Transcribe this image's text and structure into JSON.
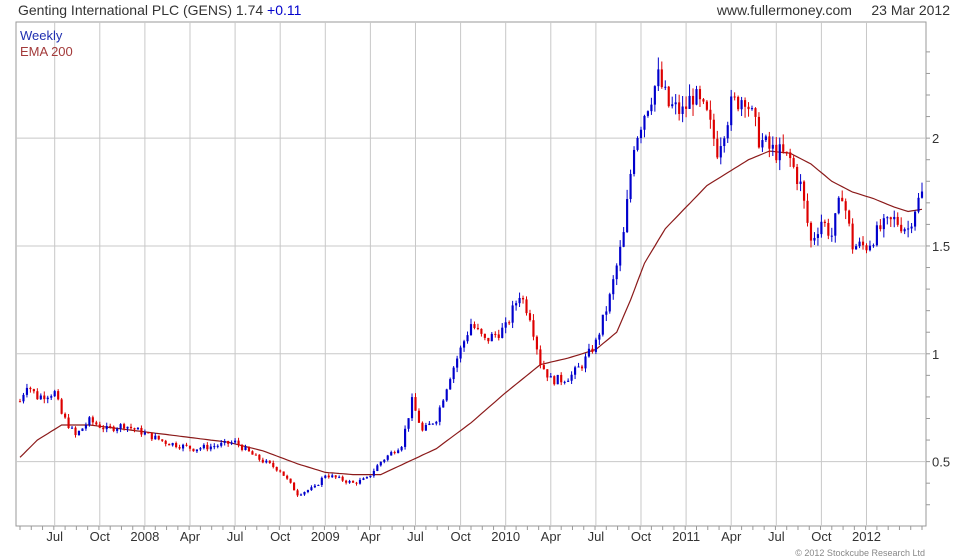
{
  "header": {
    "security": "Genting International PLC (GENS)",
    "price": "1.74",
    "change": "+0.11",
    "site": "www.fullermoney.com",
    "date": "23 Mar 2012"
  },
  "legend": {
    "weekly": "Weekly",
    "ema": "EMA 200"
  },
  "copyright": "© 2012 Stockcube Research Ltd",
  "colors": {
    "up": "#0000cc",
    "down": "#dd0000",
    "ema": "#8b1a1a",
    "grid": "#c8c8c8"
  },
  "chart_data": {
    "type": "candlestick",
    "title": "Genting International PLC (GENS)",
    "y_axis_position": "right",
    "ylim": [
      0.22,
      2.52
    ],
    "y_ticks": [
      0.5,
      1,
      1.5,
      2
    ],
    "x_ticks": [
      "Jul",
      "Oct",
      "2008",
      "Apr",
      "Jul",
      "Oct",
      "2009",
      "Apr",
      "Jul",
      "Oct",
      "2010",
      "Apr",
      "Jul",
      "Oct",
      "2011",
      "Apr",
      "Jul",
      "Oct",
      "2012"
    ],
    "x_range_weeks": [
      0,
      260
    ],
    "x_tick_weeks": [
      10,
      23,
      36,
      49,
      62,
      75,
      88,
      101,
      114,
      127,
      140,
      153,
      166,
      179,
      192,
      205,
      218,
      231,
      244
    ],
    "series": [
      {
        "name": "Weekly",
        "kind": "price",
        "anchors_week_close": [
          [
            0,
            0.78
          ],
          [
            2,
            0.86
          ],
          [
            5,
            0.8
          ],
          [
            10,
            0.82
          ],
          [
            12,
            0.72
          ],
          [
            16,
            0.62
          ],
          [
            20,
            0.69
          ],
          [
            25,
            0.65
          ],
          [
            30,
            0.67
          ],
          [
            36,
            0.63
          ],
          [
            42,
            0.59
          ],
          [
            50,
            0.56
          ],
          [
            55,
            0.57
          ],
          [
            62,
            0.59
          ],
          [
            68,
            0.52
          ],
          [
            75,
            0.46
          ],
          [
            80,
            0.35
          ],
          [
            85,
            0.38
          ],
          [
            88,
            0.44
          ],
          [
            92,
            0.42
          ],
          [
            96,
            0.4
          ],
          [
            100,
            0.42
          ],
          [
            104,
            0.5
          ],
          [
            110,
            0.58
          ],
          [
            113,
            0.78
          ],
          [
            116,
            0.64
          ],
          [
            120,
            0.7
          ],
          [
            124,
            0.9
          ],
          [
            127,
            1.02
          ],
          [
            130,
            1.14
          ],
          [
            134,
            1.06
          ],
          [
            137,
            1.09
          ],
          [
            140,
            1.12
          ],
          [
            144,
            1.28
          ],
          [
            147,
            1.18
          ],
          [
            150,
            0.96
          ],
          [
            153,
            0.88
          ],
          [
            156,
            0.88
          ],
          [
            159,
            0.9
          ],
          [
            162,
            0.95
          ],
          [
            166,
            1.05
          ],
          [
            170,
            1.26
          ],
          [
            174,
            1.55
          ],
          [
            177,
            1.98
          ],
          [
            180,
            2.12
          ],
          [
            184,
            2.28
          ],
          [
            187,
            2.15
          ],
          [
            191,
            2.12
          ],
          [
            194,
            2.2
          ],
          [
            198,
            2.1
          ],
          [
            201,
            1.95
          ],
          [
            205,
            2.15
          ],
          [
            209,
            2.2
          ],
          [
            213,
            2.0
          ],
          [
            216,
            1.95
          ],
          [
            219,
            1.93
          ],
          [
            222,
            1.9
          ],
          [
            225,
            1.78
          ],
          [
            228,
            1.52
          ],
          [
            231,
            1.62
          ],
          [
            234,
            1.55
          ],
          [
            237,
            1.75
          ],
          [
            240,
            1.5
          ],
          [
            244,
            1.5
          ],
          [
            248,
            1.58
          ],
          [
            252,
            1.62
          ],
          [
            256,
            1.58
          ],
          [
            258,
            1.68
          ],
          [
            260,
            1.74
          ]
        ]
      },
      {
        "name": "EMA 200",
        "kind": "line",
        "anchors_week_value": [
          [
            0,
            0.52
          ],
          [
            5,
            0.6
          ],
          [
            12,
            0.67
          ],
          [
            20,
            0.67
          ],
          [
            30,
            0.65
          ],
          [
            40,
            0.63
          ],
          [
            50,
            0.61
          ],
          [
            60,
            0.59
          ],
          [
            70,
            0.55
          ],
          [
            80,
            0.49
          ],
          [
            88,
            0.45
          ],
          [
            96,
            0.44
          ],
          [
            104,
            0.44
          ],
          [
            112,
            0.5
          ],
          [
            120,
            0.56
          ],
          [
            130,
            0.68
          ],
          [
            140,
            0.82
          ],
          [
            150,
            0.95
          ],
          [
            158,
            0.98
          ],
          [
            166,
            1.02
          ],
          [
            172,
            1.1
          ],
          [
            176,
            1.25
          ],
          [
            180,
            1.42
          ],
          [
            186,
            1.58
          ],
          [
            192,
            1.68
          ],
          [
            198,
            1.78
          ],
          [
            204,
            1.84
          ],
          [
            210,
            1.9
          ],
          [
            216,
            1.94
          ],
          [
            222,
            1.93
          ],
          [
            228,
            1.88
          ],
          [
            234,
            1.8
          ],
          [
            240,
            1.75
          ],
          [
            246,
            1.72
          ],
          [
            252,
            1.68
          ],
          [
            256,
            1.66
          ],
          [
            260,
            1.67
          ]
        ]
      }
    ]
  }
}
